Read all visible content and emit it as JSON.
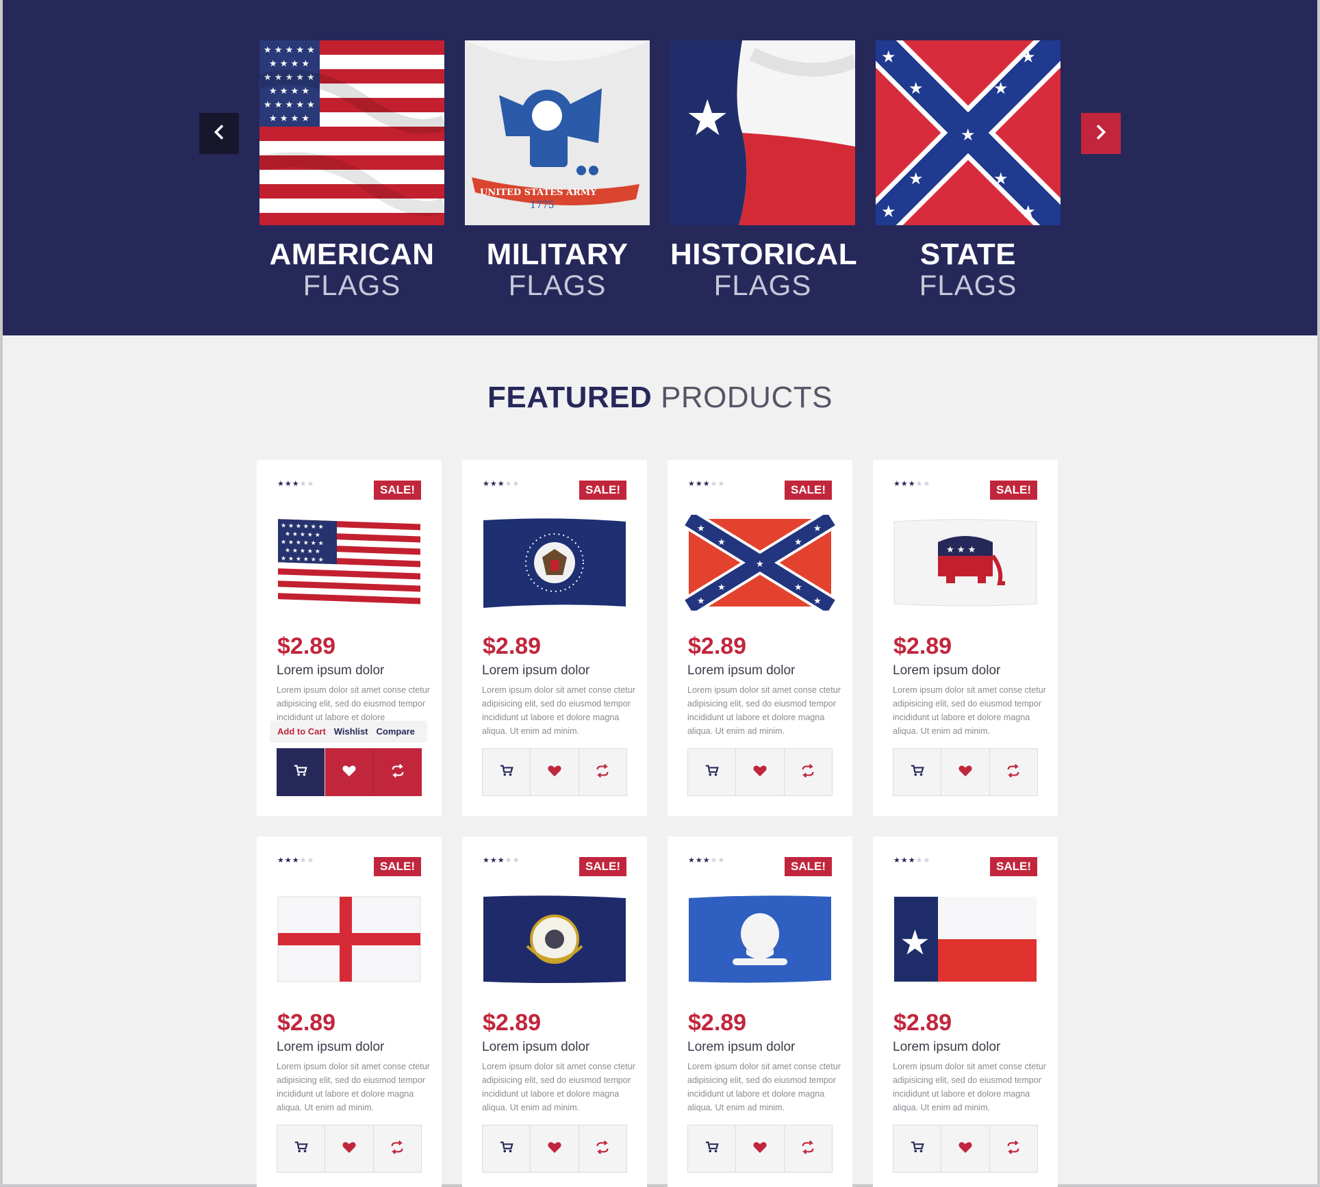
{
  "hero": {
    "prev_icon": "chevron-left-icon",
    "next_icon": "chevron-right-icon",
    "categories": [
      {
        "title": "AMERICAN",
        "subtitle": "FLAGS",
        "image": "american-flag"
      },
      {
        "title": "MILITARY",
        "subtitle": "FLAGS",
        "image": "us-army-flag"
      },
      {
        "title": "HISTORICAL",
        "subtitle": "FLAGS",
        "image": "texas-flag"
      },
      {
        "title": "STATE",
        "subtitle": "FLAGS",
        "image": "confederate-flag"
      }
    ],
    "army_banner": "UNITED STATES ARMY",
    "army_year": "1775"
  },
  "featured": {
    "title_bold": "FEATURED",
    "title_light": "PRODUCTS"
  },
  "colors": {
    "navy": "#27285a",
    "red": "#c1263c",
    "page_bg": "#f1f1f2"
  },
  "products": [
    {
      "image": "american-flag",
      "rating": 3,
      "badge": "SALE!",
      "price": "$2.89",
      "name": "Lorem ipsum dolor",
      "desc": "Lorem ipsum dolor sit amet conse ctetur adipisicing elit, sed do eiusmod tempor incididunt ut labore et dolore"
    },
    {
      "image": "presidential-seal-flag",
      "rating": 3,
      "badge": "SALE!",
      "price": "$2.89",
      "name": "Lorem ipsum dolor",
      "desc": "Lorem ipsum dolor sit amet conse ctetur adipisicing elit, sed do eiusmod tempor incididunt ut labore et dolore magna aliqua. Ut enim ad minim."
    },
    {
      "image": "confederate-flag",
      "rating": 3,
      "badge": "SALE!",
      "price": "$2.89",
      "name": "Lorem ipsum dolor",
      "desc": "Lorem ipsum dolor sit amet conse ctetur adipisicing elit, sed do eiusmod tempor incididunt ut labore et dolore magna aliqua. Ut enim ad minim."
    },
    {
      "image": "republican-elephant-flag",
      "rating": 3,
      "badge": "SALE!",
      "price": "$2.89",
      "name": "Lorem ipsum dolor",
      "desc": "Lorem ipsum dolor sit amet conse ctetur adipisicing elit, sed do eiusmod tempor incididunt ut labore et dolore magna aliqua. Ut enim ad minim."
    },
    {
      "image": "england-flag",
      "rating": 3,
      "badge": "SALE!",
      "price": "$2.89",
      "name": "Lorem ipsum dolor",
      "desc": "Lorem ipsum dolor sit amet conse ctetur adipisicing elit, sed do eiusmod tempor incididunt ut labore et dolore magna aliqua. Ut enim ad minim."
    },
    {
      "image": "kentucky-flag",
      "rating": 3,
      "badge": "SALE!",
      "price": "$2.89",
      "name": "Lorem ipsum dolor",
      "desc": "Lorem ipsum dolor sit amet conse ctetur adipisicing elit, sed do eiusmod tempor incididunt ut labore et dolore magna aliqua. Ut enim ad minim."
    },
    {
      "image": "louisiana-flag",
      "rating": 3,
      "badge": "SALE!",
      "price": "$2.89",
      "name": "Lorem ipsum dolor",
      "desc": "Lorem ipsum dolor sit amet conse ctetur adipisicing elit, sed do eiusmod tempor incididunt ut labore et dolore magna aliqua. Ut enim ad minim."
    },
    {
      "image": "texas-flag",
      "rating": 3,
      "badge": "SALE!",
      "price": "$2.89",
      "name": "Lorem ipsum dolor",
      "desc": "Lorem ipsum dolor sit amet conse ctetur adipisicing elit, sed do eiusmod tempor incididunt ut labore et dolore magna aliqua. Ut enim ad minim."
    }
  ],
  "card_actions": {
    "cart_label": "Add to Cart",
    "wishlist_label": "Wishlist",
    "compare_label": "Compare",
    "cart_icon": "cart-icon",
    "wishlist_icon": "heart-icon",
    "compare_icon": "compare-icon"
  }
}
